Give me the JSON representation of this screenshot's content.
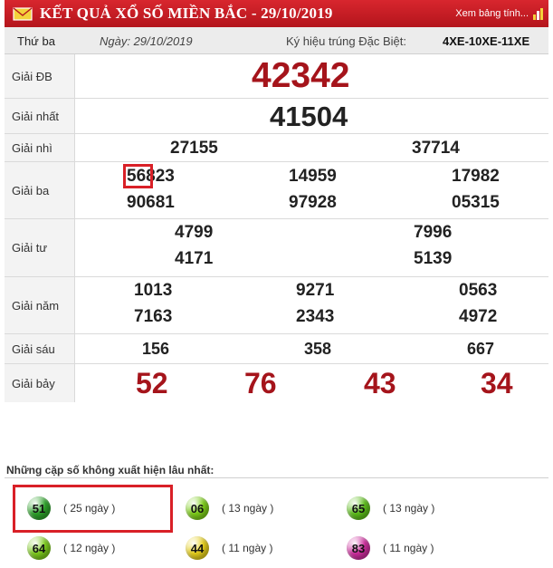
{
  "header": {
    "title": "KẾT QUẢ XỔ SỐ MIỀN BẮC - 29/10/2019",
    "view_link": "Xem bảng tính...",
    "color": "#c41e25"
  },
  "subheader": {
    "day": "Thứ ba",
    "date": "Ngày: 29/10/2019",
    "code_label": "Ký hiệu trúng Đặc Biệt:",
    "code": "4XE-10XE-11XE"
  },
  "prizes": {
    "db": {
      "label": "Giải ĐB",
      "numbers": [
        "42342"
      ]
    },
    "nhat": {
      "label": "Giải nhất",
      "numbers": [
        "41504"
      ]
    },
    "nhi": {
      "label": "Giải nhì",
      "numbers": [
        "27155",
        "37714"
      ]
    },
    "ba": {
      "label": "Giải ba",
      "numbers": [
        "56823",
        "14959",
        "17982",
        "90681",
        "97928",
        "05315"
      ]
    },
    "tu": {
      "label": "Giải tư",
      "numbers": [
        "4799",
        "7996",
        "4171",
        "5139"
      ]
    },
    "nam": {
      "label": "Giải năm",
      "numbers": [
        "1013",
        "9271",
        "0563",
        "7163",
        "2343",
        "4972"
      ]
    },
    "sau": {
      "label": "Giải sáu",
      "numbers": [
        "156",
        "358",
        "667"
      ]
    },
    "bay": {
      "label": "Giải bảy",
      "numbers": [
        "52",
        "76",
        "43",
        "34"
      ]
    }
  },
  "missing_pairs": {
    "title": "Những cặp số không xuất hiện lâu nhất:",
    "items": [
      {
        "number": "51",
        "days": "( 25 ngày )",
        "color": "#2ea52b"
      },
      {
        "number": "06",
        "days": "( 13 ngày )",
        "color": "#7fd11a"
      },
      {
        "number": "65",
        "days": "( 13 ngày )",
        "color": "#5fc21c"
      },
      {
        "number": "64",
        "days": "( 12 ngày )",
        "color": "#7fcf1e"
      },
      {
        "number": "44",
        "days": "( 11 ngày )",
        "color": "#e9d21c"
      },
      {
        "number": "83",
        "days": "( 11 ngày )",
        "color": "#d12ea0"
      }
    ]
  }
}
